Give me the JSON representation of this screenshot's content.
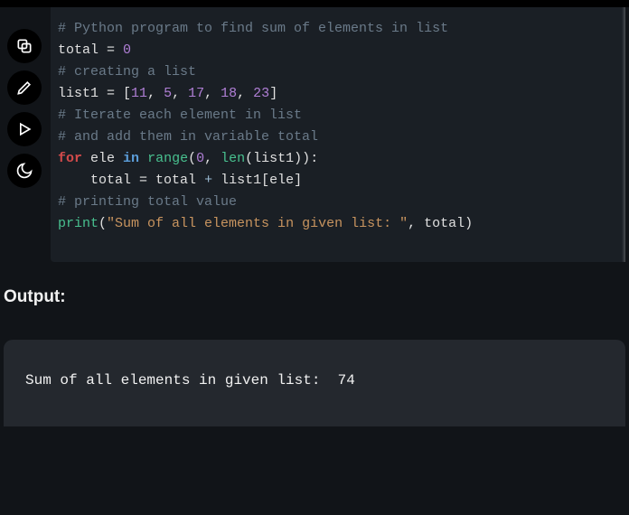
{
  "toolbar": {
    "copy": "copy",
    "edit": "edit",
    "run": "run",
    "dark": "dark"
  },
  "code": {
    "l1_comment": "# Python program to find sum of elements in list",
    "l2_total": "total",
    "l2_eq": " = ",
    "l2_zero": "0",
    "l3_empty": "",
    "l4_comment": "# creating a list",
    "l5_list": "list1",
    "l5_eq": " = ",
    "l5_lb": "[",
    "l5_v1": "11",
    "l5_c1": ", ",
    "l5_v2": "5",
    "l5_c2": ", ",
    "l5_v3": "17",
    "l5_c3": ", ",
    "l5_v4": "18",
    "l5_c4": ", ",
    "l5_v5": "23",
    "l5_rb": "]",
    "l6_empty": "",
    "l7_comment": "# Iterate each element in list",
    "l8_comment": "# and add them in variable total",
    "l9_for": "for",
    "l9_ele": " ele ",
    "l9_in": "in",
    "l9_sp": " ",
    "l9_range": "range",
    "l9_open": "(",
    "l9_zero": "0",
    "l9_comma": ", ",
    "l9_len": "len",
    "l9_open2": "(",
    "l9_lst": "list1",
    "l9_close2": "))",
    "l9_colon": ":",
    "l10_indent": "    ",
    "l10_total": "total ",
    "l10_eq": "= ",
    "l10_total2": "total ",
    "l10_plus": "+",
    "l10_sp": " ",
    "l10_lst": "list1",
    "l10_open": "[",
    "l10_ele": "ele",
    "l10_close": "]",
    "l11_empty": "",
    "l12_comment": "# printing total value",
    "l13_print": "print",
    "l13_open": "(",
    "l13_str": "\"Sum of all elements in given list: \"",
    "l13_comma": ", ",
    "l13_total": "total",
    "l13_close": ")"
  },
  "output": {
    "label": "Output:",
    "text": "Sum of all elements in given list:  74"
  }
}
